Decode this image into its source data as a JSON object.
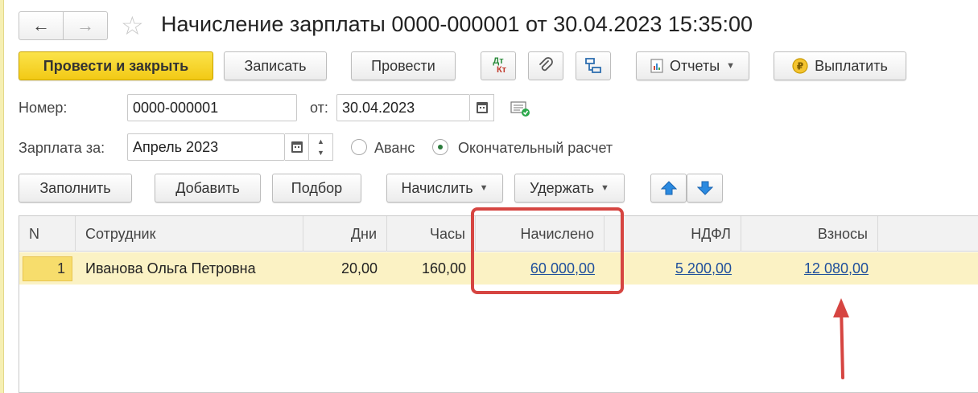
{
  "window": {
    "title": "Начисление зарплаты 0000-000001 от 30.04.2023 15:35:00",
    "nav_back": "←",
    "nav_forward": "→"
  },
  "toolbar": {
    "post_close_label": "Провести и закрыть",
    "save_label": "Записать",
    "post_label": "Провести",
    "dtkt_top": "Дт",
    "dtkt_bottom": "Кт",
    "reports_label": "Отчеты",
    "pay_label": "Выплатить"
  },
  "form": {
    "number_label": "Номер:",
    "number_value": "0000-000001",
    "date_label": "от:",
    "date_value": "30.04.2023",
    "salary_for_label": "Зарплата за:",
    "salary_for_value": "Апрель 2023",
    "radio_advance": "Аванс",
    "radio_final": "Окончательный расчет",
    "selected_radio": "Окончательный расчет"
  },
  "table_toolbar": {
    "fill_label": "Заполнить",
    "add_label": "Добавить",
    "pick_label": "Подбор",
    "accrue_label": "Начислить",
    "withhold_label": "Удержать"
  },
  "table": {
    "headers": [
      "N",
      "Сотрудник",
      "Дни",
      "Часы",
      "Начислено",
      "НДФЛ",
      "Взносы"
    ],
    "rows": [
      {
        "n": "1",
        "employee": "Иванова Ольга Петровна",
        "days": "20,00",
        "hours": "160,00",
        "accrued": "60 000,00",
        "ndfl": "5 200,00",
        "contributions": "12 080,00"
      }
    ]
  },
  "colors": {
    "primary_button": "#f2c915",
    "selected_row": "#fbf2c4",
    "link": "#1f4f9c",
    "annotation": "#d64541",
    "arrow_buttons": "#1e7fd0"
  }
}
